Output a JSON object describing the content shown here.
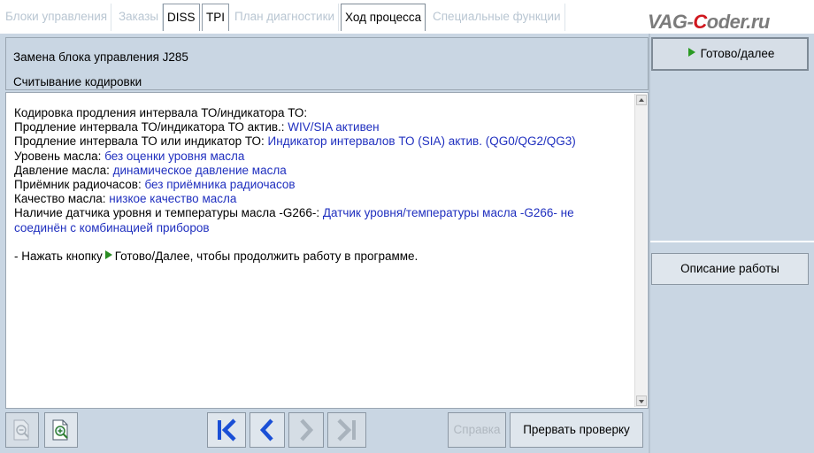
{
  "tabs": [
    {
      "label": "Блоки управления",
      "state": "disabled"
    },
    {
      "label": "Заказы",
      "state": "disabled"
    },
    {
      "label": "DISS",
      "state": "enabled"
    },
    {
      "label": "TPI",
      "state": "enabled"
    },
    {
      "label": "План диагностики",
      "state": "disabled"
    },
    {
      "label": "Ход процесса",
      "state": "active"
    },
    {
      "label": "Специальные функции",
      "state": "disabled"
    }
  ],
  "logo": {
    "part1": "VAG-",
    "part2": "C",
    "part3": "oder.ru"
  },
  "header": {
    "title": "Замена блока управления J285",
    "subtitle": "Считывание кодировки"
  },
  "content": {
    "heading": "Кодировка продления интервала ТО/индикатора ТО:",
    "rows": [
      {
        "label": "Продление интервала ТО/индикатора ТО актив.: ",
        "value": "WIV/SIA активен"
      },
      {
        "label": "Продление интервала ТО или индикатор ТО: ",
        "value": "Индикатор интервалов ТО (SIA) актив. (QG0/QG2/QG3)"
      },
      {
        "label": "Уровень масла: ",
        "value": "без оценки уровня масла"
      },
      {
        "label": "Давление масла: ",
        "value": "динамическое давление масла"
      },
      {
        "label": "Приёмник радиочасов: ",
        "value": "без приёмника радиочасов"
      },
      {
        "label": "Качество масла: ",
        "value": "низкое качество масла"
      },
      {
        "label": "Наличие датчика уровня и температуры масла -G266-: ",
        "value": "Датчик уровня/температуры масла -G266- не"
      }
    ],
    "row_continuation": "соединён с комбинацией приборов",
    "instruction_prefix": "- Нажать кнопку",
    "instruction_suffix": "Готово/Далее, чтобы продолжить работу в программе."
  },
  "toolbar": {
    "help_label": "Справка",
    "abort_label": "Прервать проверку"
  },
  "right_panel": {
    "ready_label": "Готово/далее",
    "description_label": "Описание работы"
  },
  "colors": {
    "background": "#c9d6e3",
    "value_text": "#1f2fbf",
    "nav_arrow": "#1a4fd6",
    "play_icon": "#2a8c22",
    "logo_accent": "#d0181f"
  }
}
